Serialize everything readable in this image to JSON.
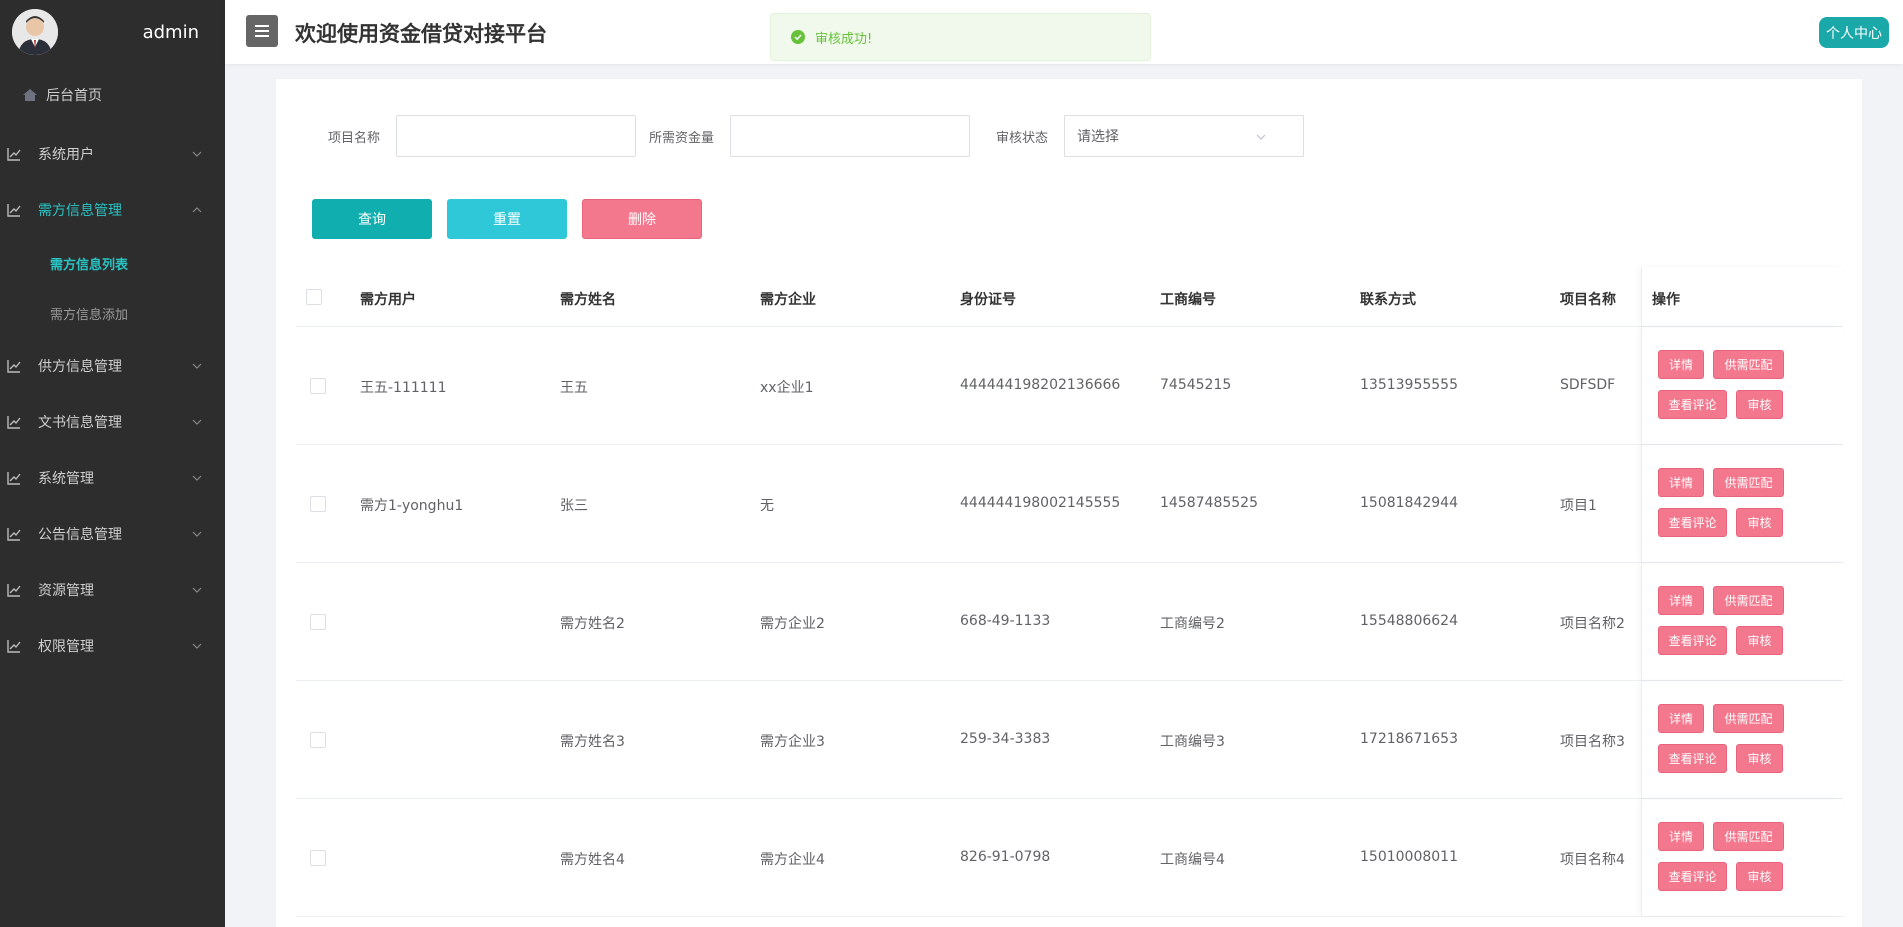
{
  "sidebar": {
    "username": "admin",
    "home": "后台首页",
    "items": [
      {
        "label": "系统用户"
      },
      {
        "label": "需方信息管理"
      },
      {
        "label": "供方信息管理"
      },
      {
        "label": "文书信息管理"
      },
      {
        "label": "系统管理"
      },
      {
        "label": "公告信息管理"
      },
      {
        "label": "资源管理"
      },
      {
        "label": "权限管理"
      }
    ],
    "sub_items": [
      {
        "label": "需方信息列表"
      },
      {
        "label": "需方信息添加"
      }
    ],
    "colors": {
      "bg": "#2d2d2d",
      "accent": "#29c3c4"
    }
  },
  "header": {
    "title": "欢迎使用资金借贷对接平台",
    "profile_button": "个人中心"
  },
  "toast": {
    "message": "审核成功!"
  },
  "search": {
    "project_label": "项目名称",
    "project_value": "",
    "amount_label": "所需资金量",
    "amount_value": "",
    "status_label": "审核状态",
    "status_placeholder": "请选择",
    "search_button": "查询",
    "reset_button": "重置",
    "delete_button": "删除"
  },
  "table": {
    "headers": [
      "需方用户",
      "需方姓名",
      "需方企业",
      "身份证号",
      "工商编号",
      "联系方式",
      "项目名称",
      "操作"
    ],
    "rows": [
      [
        "王五-111111",
        "王五",
        "xx企业1",
        "444444198202136666",
        "74545215",
        "13513955555",
        "SDFSDF"
      ],
      [
        "需方1-yonghu1",
        "张三",
        "无",
        "444444198002145555",
        "14587485525",
        "15081842944",
        "项目1"
      ],
      [
        "",
        "需方姓名2",
        "需方企业2",
        "668-49-1133",
        "工商编号2",
        "15548806624",
        "项目名称2"
      ],
      [
        "",
        "需方姓名3",
        "需方企业3",
        "259-34-3383",
        "工商编号3",
        "17218671653",
        "项目名称3"
      ],
      [
        "",
        "需方姓名4",
        "需方企业4",
        "826-91-0798",
        "工商编号4",
        "15010008011",
        "项目名称4"
      ]
    ],
    "ops": {
      "detail": "详情",
      "match": "供需匹配",
      "comments": "查看评论",
      "review": "审核"
    }
  }
}
